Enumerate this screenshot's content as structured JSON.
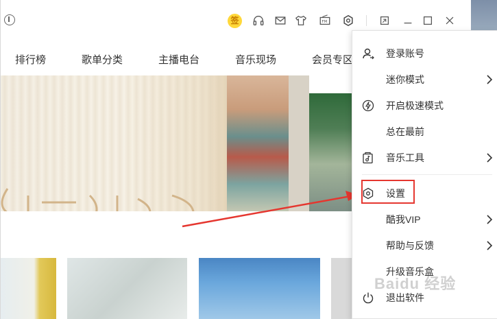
{
  "titlebar": {
    "sign_badge": "签"
  },
  "nav": {
    "items": [
      "排行榜",
      "歌单分类",
      "主播电台",
      "音乐现场",
      "会员专区"
    ]
  },
  "menu": {
    "items": [
      {
        "label": "登录账号",
        "icon": "user-login-icon",
        "has_submenu": false
      },
      {
        "label": "迷你模式",
        "icon": "",
        "has_submenu": true
      },
      {
        "label": "开启极速模式",
        "icon": "lightning-icon",
        "has_submenu": false
      },
      {
        "label": "总在最前",
        "icon": "",
        "has_submenu": false
      },
      {
        "label": "音乐工具",
        "icon": "music-tool-icon",
        "has_submenu": true
      },
      {
        "label": "设置",
        "icon": "settings-icon",
        "has_submenu": false
      },
      {
        "label": "酷我VIP",
        "icon": "",
        "has_submenu": true
      },
      {
        "label": "帮助与反馈",
        "icon": "",
        "has_submenu": true
      },
      {
        "label": "升级音乐盒",
        "icon": "",
        "has_submenu": false
      },
      {
        "label": "退出软件",
        "icon": "power-icon",
        "has_submenu": false
      }
    ]
  },
  "colors": {
    "annotation_red": "#e5362f",
    "badge_yellow": "#ffd83a"
  },
  "watermark": "Baidu 经验"
}
